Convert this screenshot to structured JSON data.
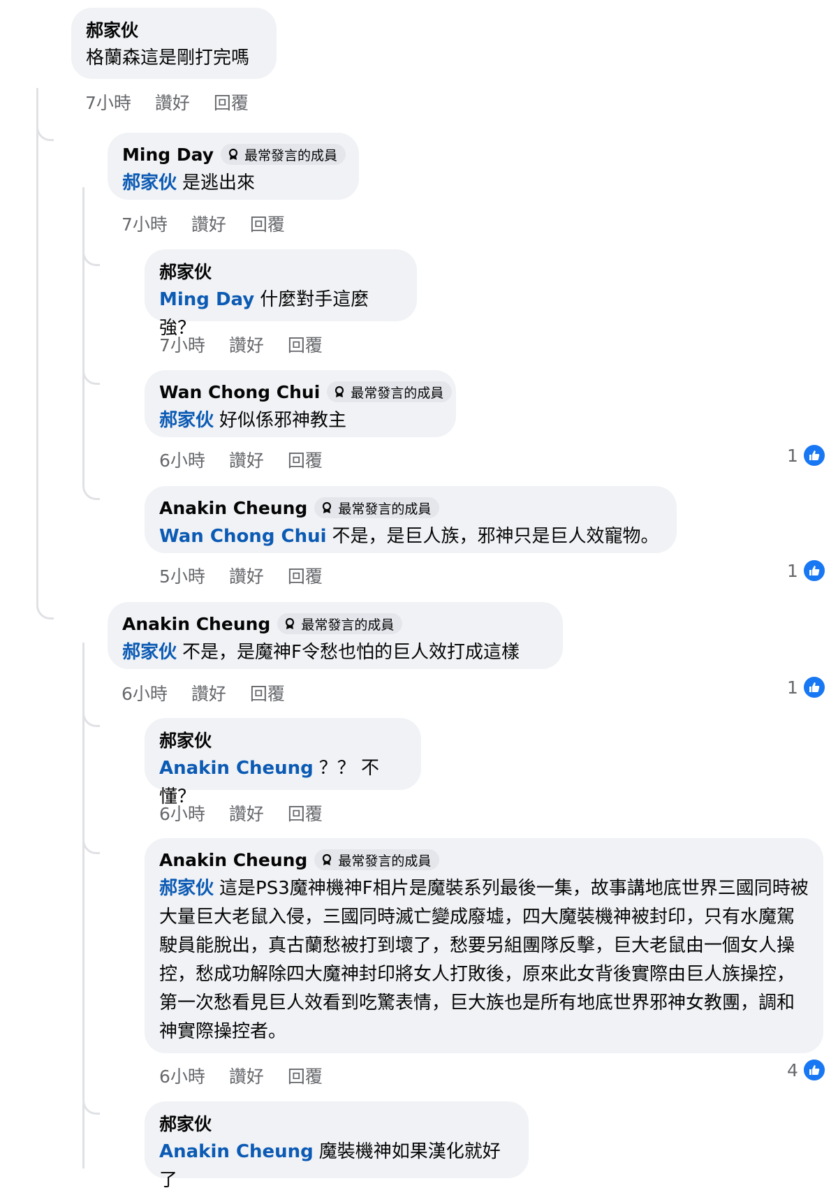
{
  "badge_label": "最常發言的成員",
  "actions": {
    "like": "讚好",
    "reply": "回覆"
  },
  "comments": [
    {
      "author": "郝家伙",
      "mention": "",
      "text": "格蘭森這是剛打完嗎",
      "time": "7小時",
      "badge": false,
      "reactions": ""
    },
    {
      "author": "Ming Day",
      "mention": "郝家伙",
      "text": "是逃出來",
      "time": "7小時",
      "badge": true,
      "reactions": ""
    },
    {
      "author": "郝家伙",
      "mention": "Ming Day",
      "text": "什麼對手這麼強？",
      "time": "7小時",
      "badge": false,
      "reactions": ""
    },
    {
      "author": "Wan Chong Chui",
      "mention": "郝家伙",
      "text": "好似係邪神教主",
      "time": "6小時",
      "badge": true,
      "reactions": "1"
    },
    {
      "author": "Anakin Cheung",
      "mention": "Wan Chong Chui",
      "text": "不是，是巨人族，邪神只是巨人效寵物。",
      "time": "5小時",
      "badge": true,
      "reactions": "1"
    },
    {
      "author": "Anakin Cheung",
      "mention": "郝家伙",
      "text": "不是，是魔神F令愁也怕的巨人效打成這樣",
      "time": "6小時",
      "badge": true,
      "reactions": "1"
    },
    {
      "author": "郝家伙",
      "mention": "Anakin Cheung",
      "text": "？？ 不懂？",
      "time": "6小時",
      "badge": false,
      "reactions": ""
    },
    {
      "author": "Anakin Cheung",
      "mention": "郝家伙",
      "text": "這是PS3魔神機神F相片是魔裝系列最後一集，故事講地底世界三國同時被大量巨大老鼠入侵，三國同時滅亡變成廢墟，四大魔裝機神被封印，只有水魔駕駛員能脫出，真古蘭愁被打到壞了，愁要另組團隊反擊，巨大老鼠由一個女人操控，愁成功解除四大魔神封印將女人打敗後，原來此女背後實際由巨人族操控，第一次愁看見巨人效看到吃驚表情，巨大族也是所有地底世界邪神女教團，調和神實際操控者。",
      "time": "6小時",
      "badge": true,
      "reactions": "4"
    },
    {
      "author": "郝家伙",
      "mention": "Anakin Cheung",
      "text": "魔裝機神如果漢化就好了",
      "time": "",
      "badge": false,
      "reactions": ""
    }
  ]
}
